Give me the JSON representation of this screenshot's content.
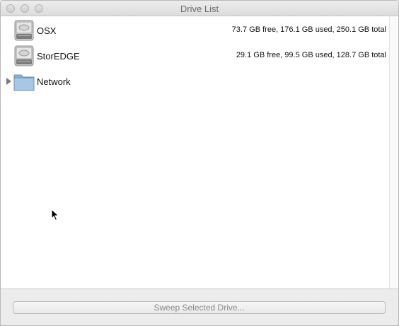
{
  "window": {
    "title": "Drive List"
  },
  "drives": [
    {
      "name": "OSX",
      "info": "73.7 GB free, 176.1 GB used, 250.1 GB total",
      "icon": "hard-drive-icon"
    },
    {
      "name": "StorEDGE",
      "info": "29.1 GB free, 99.5 GB used, 128.7 GB total",
      "icon": "hard-drive-icon"
    }
  ],
  "network": {
    "name": "Network",
    "icon": "folder-icon"
  },
  "footer": {
    "sweep_label": "Sweep Selected Drive..."
  }
}
